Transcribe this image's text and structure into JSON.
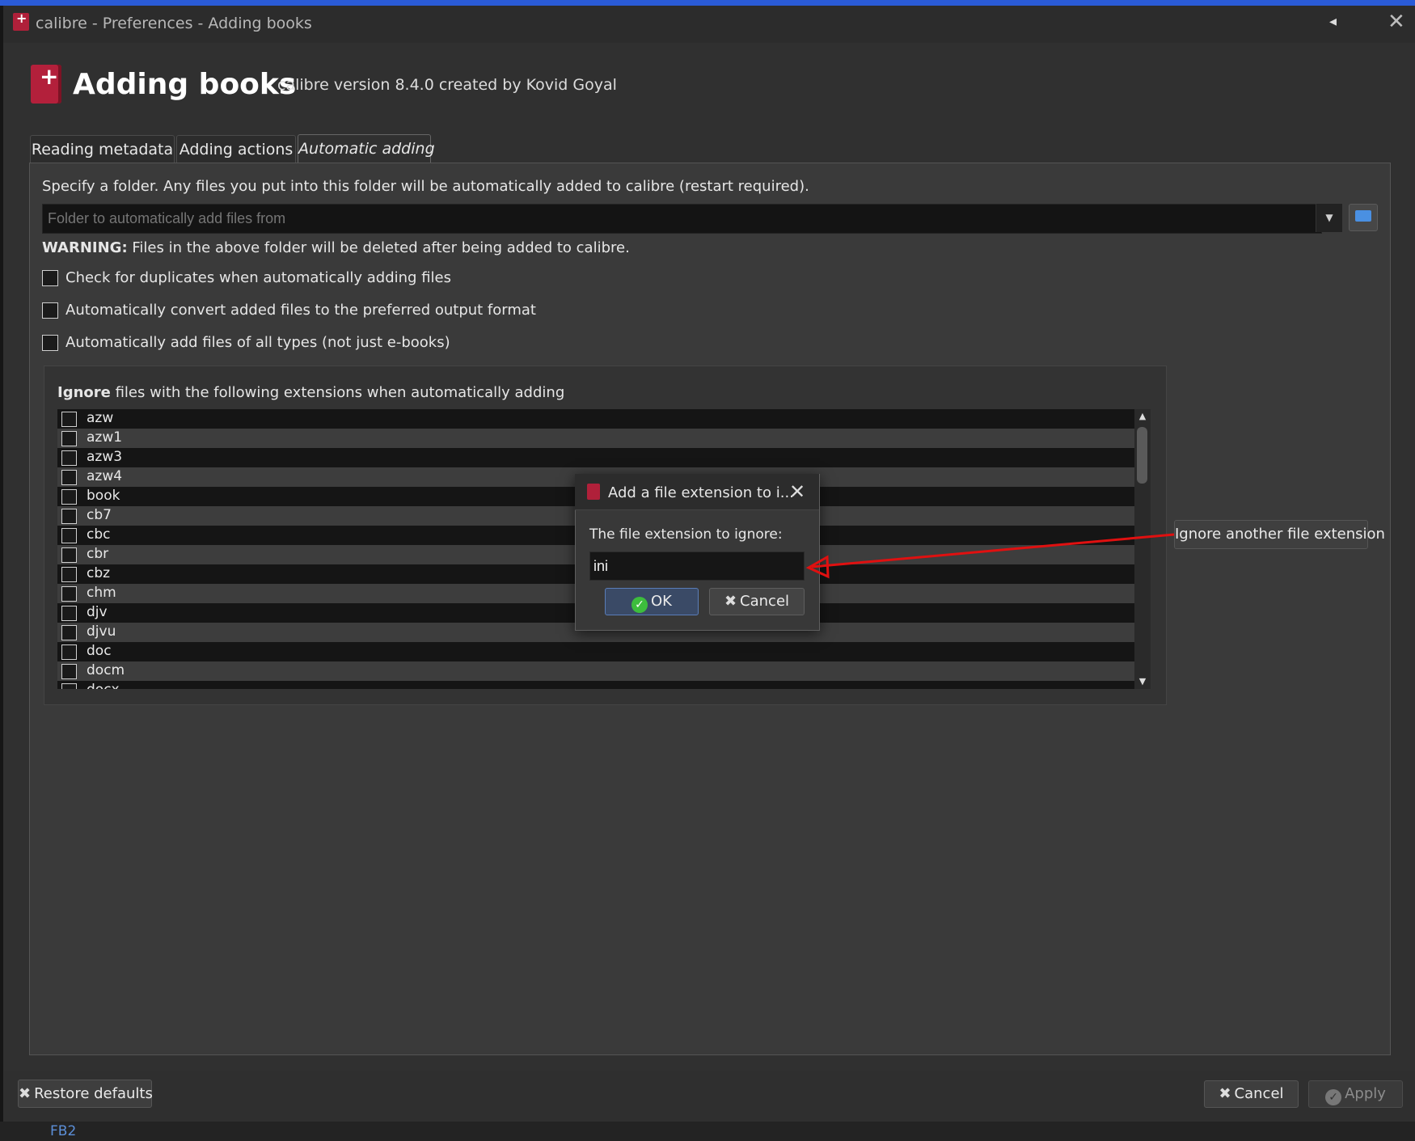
{
  "window": {
    "title": "calibre - Preferences - Adding books"
  },
  "header": {
    "title": "Adding books",
    "subtitle": "calibre version 8.4.0 created by Kovid Goyal"
  },
  "tabs": [
    {
      "label": "Reading metadata",
      "active": false
    },
    {
      "label": "Adding actions",
      "active": false
    },
    {
      "label": "Automatic adding",
      "active": true
    }
  ],
  "auto_add": {
    "folder_description": "Specify a folder. Any files you put into this folder will be automatically added to calibre (restart required).",
    "folder_placeholder": "Folder to automatically add files from",
    "warning_label": "WARNING:",
    "warning_text": " Files in the above folder will be deleted after being added to calibre.",
    "options": [
      {
        "label": "Check for duplicates when automatically adding files",
        "checked": false
      },
      {
        "label": "Automatically convert added files to the preferred output format",
        "checked": false
      },
      {
        "label": "Automatically add files of all types (not just e-books)",
        "checked": false
      }
    ],
    "ignore_bold": "Ignore",
    "ignore_rest": " files with the following extensions when automatically adding",
    "extensions": [
      "azw",
      "azw1",
      "azw3",
      "azw4",
      "book",
      "cb7",
      "cbc",
      "cbr",
      "cbz",
      "chm",
      "djv",
      "djvu",
      "doc",
      "docm",
      "docx"
    ],
    "ignore_another_label": "Ignore another file extension"
  },
  "dialog": {
    "title": "Add a file extension to i...",
    "prompt": "The file extension to ignore:",
    "value": "ini",
    "ok_label": "OK",
    "cancel_label": "Cancel"
  },
  "footer": {
    "restore_label": "Restore defaults",
    "cancel_label": "Cancel",
    "apply_label": "Apply"
  },
  "background": {
    "bottom_label": "FB2"
  },
  "colors": {
    "accent": "#2a5bd7",
    "annotation_arrow": "#e01010",
    "logo": "#b0203a"
  }
}
